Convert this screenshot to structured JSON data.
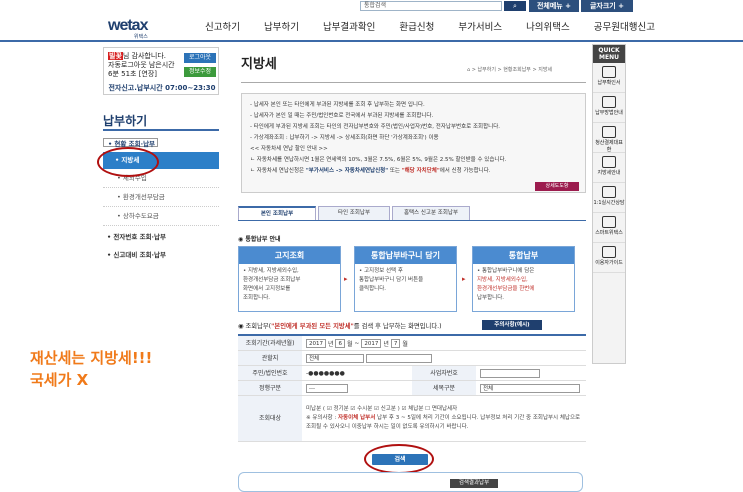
{
  "topbar": {
    "search_select": "통합검색",
    "all_menu": "전체메뉴 +",
    "font_size": "글자크기 +"
  },
  "logo": {
    "main": "wetax",
    "sub": "위택스"
  },
  "gnb": [
    "신고하기",
    "납부하기",
    "납부결과확인",
    "환급신청",
    "부가서비스",
    "나의위택스",
    "공무원대행신고"
  ],
  "quick_menu": {
    "title": "QUICK MENU",
    "items": [
      "납부확인서",
      "납부방법안내",
      "청산결제대표환",
      "지방세안내",
      "1:1실시간상담",
      "스마트위택스",
      "이용자가이드"
    ]
  },
  "login": {
    "badge": "빌꽃",
    "greeting": "님 감사합니다.",
    "remain_label": "자동로그아웃 남은시간",
    "remain_time": "6분 51초 [연장]",
    "logout": "로그아웃",
    "myinfo": "정보수정",
    "service_time": "전자신고.납부시간 07:00~23:30"
  },
  "lnb": {
    "title": "납부하기",
    "group1": "• 현황 조회·납부",
    "selected": "• 지방세",
    "sub_items": [
      "• 세외수입",
      "• 환경개선부담금",
      "• 상하수도요금"
    ],
    "group2": "• 전자번호 조회·납부",
    "group3": "• 신고대비 조회·납부"
  },
  "page": {
    "title": "지방세",
    "breadcrumb": "⌂ > 납부하기 > 현황조회납부 > 지방세"
  },
  "info": {
    "lines": [
      "- 납세자 본인 또는 타인에게 부과된 지방세를 조회 후 납부하는 화면 입니다.",
      "- 납세자가 본인 일 때는 주민/법인번호로 전국에서 부과된 지방세를 조회합니다.",
      "- 타인에게 부과된 지방세 조회는 타인의 전자납부번호와 주민(법인/사업자)번호, 전자납부번호로 조회합니다.",
      "- 가상계좌조회 : 납부하기 -> 지방세 -> 상세조회(화면 하단 '가상계좌조회') 이용"
    ],
    "discount_title": "<< 자동차세 연납 할인 안내 >>",
    "discount_line1": "ㄴ 자동차세를 연납하시면 1월은 연세액의 10%, 3월은 7.5%, 6월은 5%, 9월은 2.5% 할인받을 수 있습니다.",
    "discount_line2_pre": "ㄴ 자동차세 연납신청은 ",
    "discount_line2_link1": "\"부가서비스 -> 자동차세연납신청\"",
    "discount_line2_mid": " 또는 ",
    "discount_line2_link2": "\"해당 자치단체\"",
    "discount_line2_post": "에서 신청 가능합니다.",
    "detail_btn": "상세도도항"
  },
  "tabs": [
    "본인 조회납부",
    "타인 조회납부",
    "홈택스 신고분 조회납부"
  ],
  "guide": {
    "title": "◉ 통합납부 안내",
    "cards": [
      {
        "head": "고지조회",
        "lines": [
          "• 지방세, 지방세외수입,",
          "환경개선부담금 조회납부",
          "화면에서 고지정보를",
          "조회합니다."
        ]
      },
      {
        "head": "통합납부바구니 담기",
        "lines": [
          "• 고지정보 선택 후",
          "통합납부바구니 담기 버튼을",
          "클릭합니다."
        ]
      },
      {
        "head": "통합납부",
        "lines": [
          "• 통합납부바구니에 담은",
          "지방세, 지방세외수입,",
          "환경개선부담금을 한번에",
          "납부합니다."
        ]
      }
    ]
  },
  "search": {
    "title_pre": "◉ 조회납부(",
    "title_red": "\"본인에게 부과된 모든 지방세\"",
    "title_post": "를 검색 후 납부하는 화면입니다.)",
    "notice_btn": "주의사항(예시)",
    "labels": {
      "period": "조회기간(과세년월)",
      "region": "관할지",
      "id": "주민/법인번호",
      "biz": "사업자번호",
      "category": "정행구분",
      "tax_item": "세목구분",
      "target": "조회대상"
    },
    "period": {
      "y1": "2017",
      "m1": "6",
      "y2": "2017",
      "m2": "7",
      "u_year": "년",
      "u_month": "월",
      "sep": "~"
    },
    "region_value": "전체",
    "id_value": "-●●●●●●●",
    "category_value": "---",
    "tax_item_value": "전체",
    "target_options": "미납분 ( ☑ 정기분  ☑ 수시분  ☑ 신고분 )  ☑ 체납분  ☐ 면대납세자",
    "target_notice_pre": "※ 유의사항 : ",
    "target_notice_red": "자동이체 납부서",
    "target_notice_post": " 납부 후 3 ~ 5일에 처리 기간이 소요됩니다. 납부정보 처리 기간 중 조회납부시 체납으로 조회될 수 있사오니 이중납부 하시는 일이 없도록 유의하시기 바랍니다.",
    "search_btn": "검색",
    "result_btn": "검색결과납부"
  },
  "overlay_note": {
    "line1": "재산세는 지방세!!!",
    "line2": "국세가 X"
  }
}
